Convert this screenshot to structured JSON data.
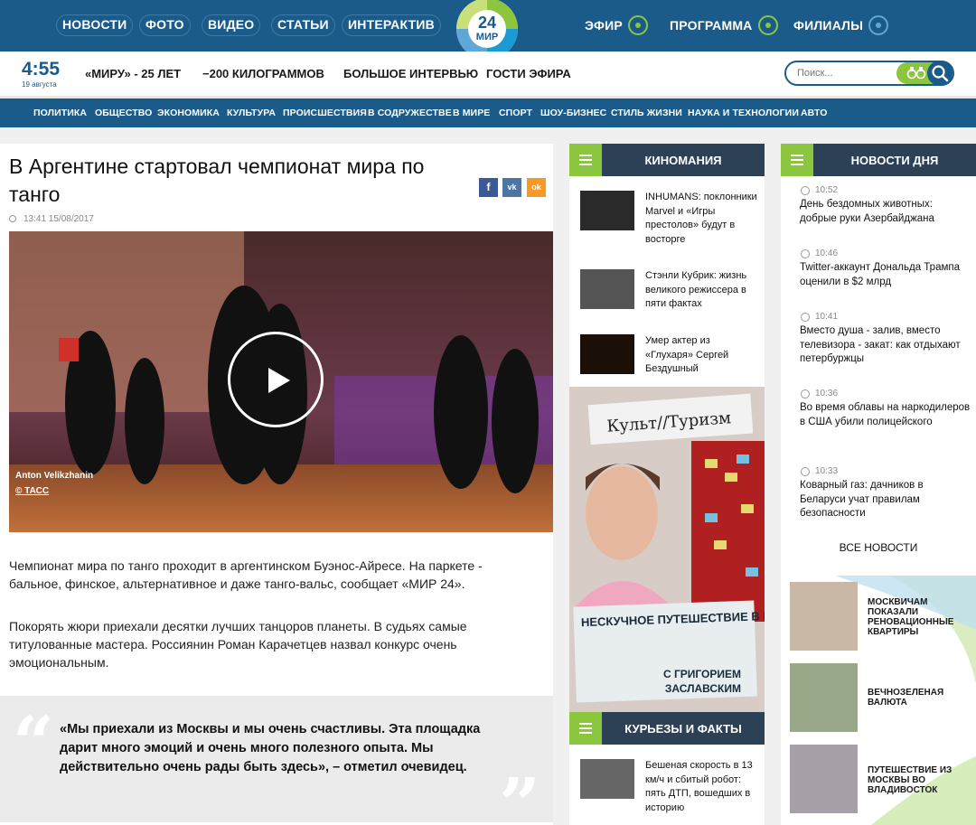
{
  "topnav": {
    "left": [
      "НОВОСТИ",
      "ФОТО",
      "ВИДЕО",
      "СТАТЬИ",
      "ИНТЕРАКТИВ"
    ],
    "right": [
      "ЭФИР",
      "ПРОГРАММА",
      "ФИЛИАЛЫ"
    ],
    "logo_number": "24",
    "logo_text": "МИР"
  },
  "subbar": {
    "time": "4:55",
    "date": "19 августа",
    "links": [
      "«МИРУ» - 25 ЛЕТ",
      "−200 КИЛОГРАММОВ",
      "БОЛЬШОЕ ИНТЕРВЬЮ",
      "ГОСТИ ЭФИРА"
    ],
    "search_placeholder": "Поиск..."
  },
  "categories": [
    "ПОЛИТИКА",
    "ОБЩЕСТВО",
    "ЭКОНОМИКА",
    "КУЛЬТУРА",
    "ПРОИСШЕСТВИЯ",
    "В СОДРУЖЕСТВЕ",
    "В МИРЕ",
    "СПОРТ",
    "ШОУ-БИЗНЕС",
    "СТИЛЬ ЖИЗНИ",
    "НАУКА И ТЕХНОЛОГИИ",
    "АВТО"
  ],
  "article": {
    "title": "В Аргентине стартовал чемпионат мира по танго",
    "meta": "13:41 15/08/2017",
    "share": [
      "f",
      "vk",
      "ok"
    ],
    "photo_credit_1": "Anton Velikzhanin",
    "photo_credit_2": "© ТАСС",
    "para1": "Чемпионат мира по танго проходит в аргентинском Буэнос-Айресе. На паркете - бальное, финское, альтернативное и даже танго-вальс, сообщает «МИР 24».",
    "para2": "Покорять жюри приехали десятки лучших танцоров планеты. В судьях самые титулованные мастера. Россиянин Роман Карачетцев назвал конкурс очень эмоциональным.",
    "quote": "«Мы приехали из Москвы и мы очень счастливы. Эта площадка дарит много эмоций и очень много полезного опыта. Мы действительно очень рады быть здесь», – отметил очевидец."
  },
  "kinomania": {
    "title": "КИНОМАНИЯ",
    "items": [
      "INHUMANS: поклонники Marvel и «Игры престолов» будут в восторге",
      "Стэнли Кубрик: жизнь великого режиссера в пяти фактах",
      "Умер актер из «Глухаря» Сергей Бездушный"
    ]
  },
  "banner": {
    "top": "Культ//Туризм",
    "middle": "НЕСКУЧНОЕ ПУТЕШЕСТВИЕ В МИР КУЛЬТУРЫ",
    "bottom_1": "С ГРИГОРИЕМ",
    "bottom_2": "ЗАСЛАВСКИМ"
  },
  "kuryozy": {
    "title": "КУРЬЕЗЫ И ФАКТЫ",
    "items": [
      "Бешеная скорость в 13 км/ч и сбитый робот: пять ДТП, вошедших в историю"
    ]
  },
  "news_day": {
    "title": "НОВОСТИ ДНЯ",
    "items": [
      {
        "time": "10:52",
        "text": "День бездомных животных: добрые руки Азербайджана"
      },
      {
        "time": "10:46",
        "text": "Twitter-аккаунт Дональда Трампа оценили в $2 млрд"
      },
      {
        "time": "10:41",
        "text": "Вместо душа - залив, вместо телевизора - закат: как отдыхают петербуржцы"
      },
      {
        "time": "10:36",
        "text": "Во время облавы на наркодилеров в США убили полицейского"
      },
      {
        "time": "10:33",
        "text": "Коварный газ: дачников в Беларуси учат правилам безопасности"
      }
    ],
    "all": "ВСЕ НОВОСТИ"
  },
  "promos": [
    "МОСКВИЧАМ ПОКАЗАЛИ РЕНОВАЦИОННЫЕ КВАРТИРЫ",
    "ВЕЧНОЗЕЛЕНАЯ ВАЛЮТА",
    "ПУТЕШЕСТВИЕ ИЗ МОСКВЫ ВО ВЛАДИВОСТОК"
  ],
  "colors": {
    "brand_blue": "#1b5b8a",
    "accent_green": "#8cc63f",
    "header_dark": "#2d4156"
  }
}
